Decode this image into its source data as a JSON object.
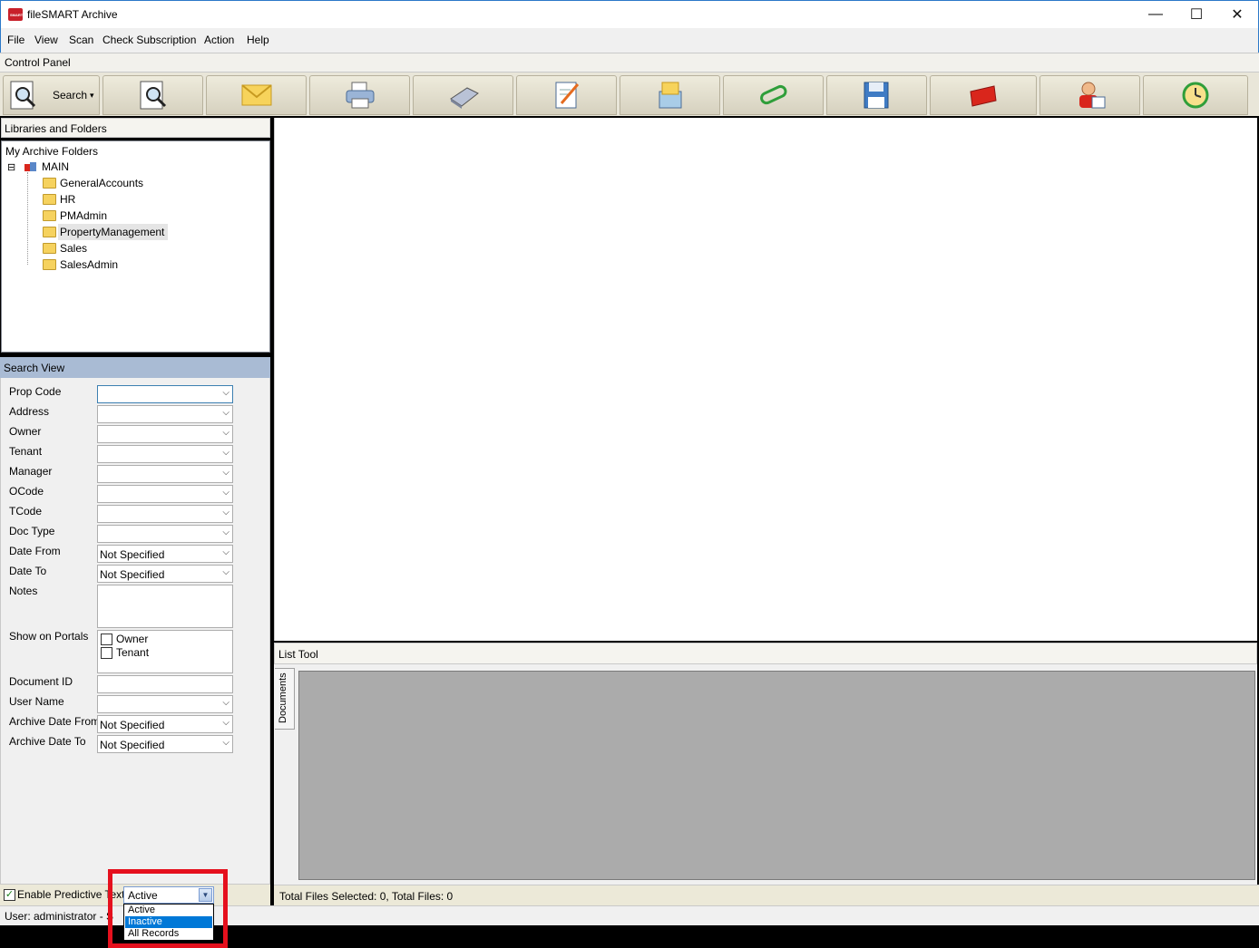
{
  "window": {
    "title": "fileSMART Archive",
    "minimize": "—",
    "maximize": "☐",
    "close": "✕"
  },
  "menu": [
    "File",
    "View",
    "Scan",
    "Check Subscription",
    "Action",
    "Help"
  ],
  "control_panel": {
    "label": "Control Panel"
  },
  "toolbar": {
    "search_label": "Search",
    "dropdown_glyph": "▾",
    "tools": [
      "search-magnifier-icon",
      "search-document-icon",
      "email-icon",
      "printer-icon",
      "scanner-icon",
      "edit-document-icon",
      "mailbox-icon",
      "paperclip-icon",
      "save-floppy-icon",
      "red-folder-icon",
      "user-card-icon",
      "history-clock-icon"
    ]
  },
  "libraries": {
    "header": "Libraries and Folders",
    "root": "My Archive Folders",
    "library": "MAIN",
    "expander": "⊟",
    "folders": [
      "GeneralAccounts",
      "HR",
      "PMAdmin",
      "PropertyManagement",
      "Sales",
      "SalesAdmin"
    ],
    "selected_folder": "PropertyManagement"
  },
  "search_view": {
    "header": "Search View",
    "fields": {
      "prop_code": {
        "label": "Prop Code",
        "value": ""
      },
      "address": {
        "label": "Address",
        "value": ""
      },
      "owner": {
        "label": "Owner",
        "value": ""
      },
      "tenant": {
        "label": "Tenant",
        "value": ""
      },
      "manager": {
        "label": "Manager",
        "value": ""
      },
      "ocode": {
        "label": "OCode",
        "value": ""
      },
      "tcode": {
        "label": "TCode",
        "value": ""
      },
      "doc_type": {
        "label": "Doc Type",
        "value": ""
      },
      "date_from": {
        "label": "Date From",
        "value": "Not Specified"
      },
      "date_to": {
        "label": "Date To",
        "value": "Not Specified"
      },
      "notes": {
        "label": "Notes",
        "value": ""
      },
      "show_on_portals": {
        "label": "Show on Portals",
        "options": [
          "Owner",
          "Tenant"
        ],
        "checked": [
          false,
          false
        ]
      },
      "document_id": {
        "label": "Document ID",
        "value": ""
      },
      "user_name": {
        "label": "User Name",
        "value": ""
      },
      "archive_date_from": {
        "label": "Archive Date From",
        "value": "Not Specified"
      },
      "archive_date_to": {
        "label": "Archive Date To",
        "value": "Not Specified"
      }
    },
    "combo_arrow": "⌵",
    "enable_predictive": {
      "label": "Enable Predictive Text",
      "checked": true,
      "check_glyph": "✓"
    },
    "status_filter": {
      "value": "Active",
      "button_glyph": "▼",
      "options": [
        "Active",
        "Inactive",
        "All Records"
      ],
      "highlighted": "Inactive"
    }
  },
  "list_tool": {
    "header": "List Tool",
    "tab": "Documents",
    "totals": "Total Files Selected: 0, Total Files: 0"
  },
  "status_bar": {
    "text": "User: administrator - S"
  },
  "colors": {
    "highlight_box": "#e5101d",
    "selection": "#0078d7",
    "search_header": "#a9bbd4",
    "grid": "#ababab"
  }
}
